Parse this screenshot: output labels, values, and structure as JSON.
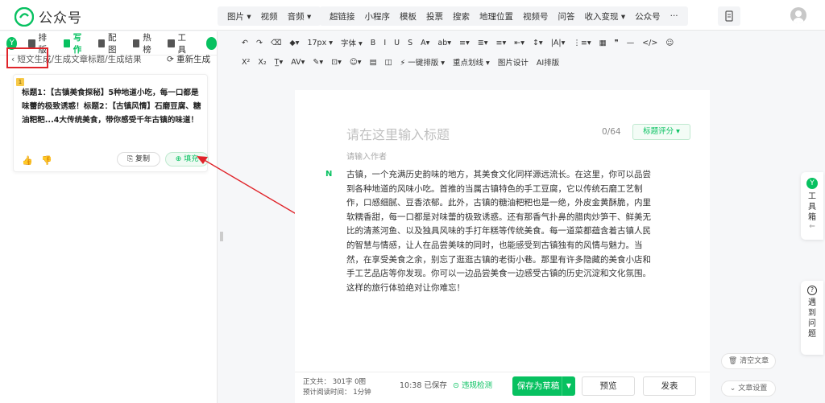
{
  "brand": {
    "name": "公众号"
  },
  "topnav": {
    "group1": [
      "图片 ▾",
      "视频",
      "音频 ▾"
    ],
    "group2": [
      "超链接",
      "小程序",
      "模板",
      "投票",
      "搜索",
      "地理位置",
      "视频号",
      "问答",
      "收入变现 ▾",
      "公众号",
      "···"
    ]
  },
  "sidebar": {
    "tabs": [
      {
        "label": "排版"
      },
      {
        "label": "写作",
        "active": true
      },
      {
        "label": "配图"
      },
      {
        "label": "热榜"
      },
      {
        "label": "工具"
      }
    ],
    "breadcrumb": "短文生成/生成文章标题/生成结果",
    "regenerate": "重新生成",
    "result": {
      "index": "1",
      "text": "标题1：【古镇美食探秘】5种地道小吃，每一口都是味蕾的极致诱惑！标题2：【古镇风情】石磨豆腐、糖油粑粑...4大传统美食，带你感受千年古镇的味道！",
      "copy_label": "复制",
      "fill_label": "填充"
    }
  },
  "toolbar": {
    "row1": [
      "↶",
      "↷",
      "⌫",
      "◆▾",
      "17px ▾",
      "字体 ▾",
      "B",
      "I",
      "U",
      "S",
      "A▾",
      "ab▾",
      "≡▾",
      "≣▾",
      "≡▾",
      "⇤▾",
      "↕▾",
      "|A|▾",
      "⋮≡▾",
      "▦",
      "❞",
      "—",
      "</>",
      "☺"
    ],
    "row2": [
      "X²",
      "X₂",
      "T̲▾",
      "AV▾",
      "✎▾",
      "⊡▾",
      "☺▾",
      "▤",
      "◫",
      "⚡ 一键排版 ▾",
      "重点划线 ▾",
      "图片设计",
      "AI排版"
    ]
  },
  "editor": {
    "title_placeholder": "请在这里输入标题",
    "title_count": "0/64",
    "title_score": "标题评分 ▾",
    "author_placeholder": "请输入作者",
    "body": "古镇，一个充满历史韵味的地方，其美食文化同样源远流长。在这里，你可以品尝到各种地道的风味小吃。首推的当属古镇特色的手工豆腐，它以传统石磨工艺制作，口感细腻、豆香浓郁。此外，古镇的糖油粑粑也是一绝，外皮金黄酥脆，内里软糯香甜，每一口都是对味蕾的极致诱惑。还有那香气扑鼻的腊肉炒笋干、鲜美无比的清蒸河鱼、以及独具风味的手打年糕等传统美食。每一道菜都蕴含着古镇人民的智慧与情感，让人在品尝美味的同时，也能感受到古镇独有的风情与魅力。当然，在享受美食之余，别忘了逛逛古镇的老街小巷。那里有许多隐藏的美食小店和手工艺品店等你发现。你可以一边品尝美食一边感受古镇的历史沉淀和文化氛围。这样的旅行体验绝对让你难忘！"
  },
  "bottombar": {
    "stats_line1": "正文共： 301字 0图",
    "stats_line2": "预计阅读时间： 1分钟",
    "save_time": "10:38  已保存",
    "violation_check": "违规检测",
    "save_draft": "保存为草稿",
    "preview": "预览",
    "publish": "发表"
  },
  "rightrail": {
    "toolbox": "工具箱",
    "ask": "遇到问题",
    "clear": "清空文章",
    "settings": "文章设置"
  },
  "colors": {
    "accent": "#07c160",
    "highlight": "#e0242a"
  }
}
